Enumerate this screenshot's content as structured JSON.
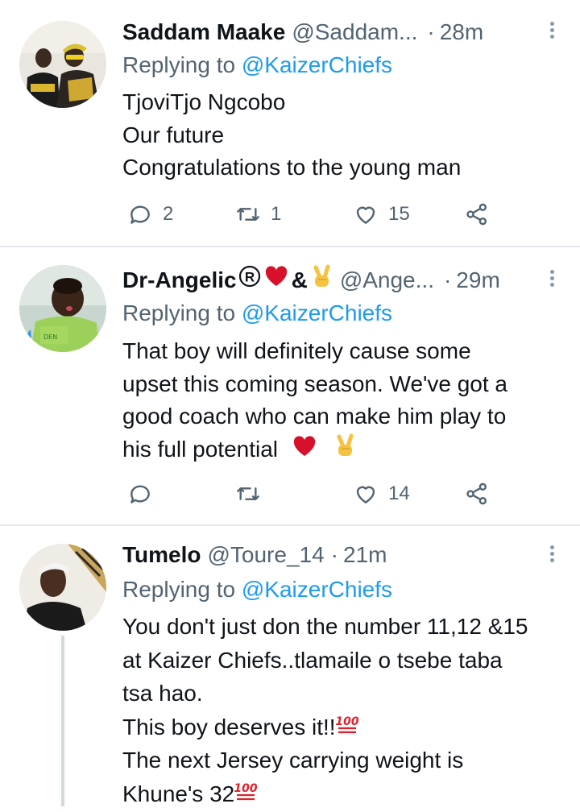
{
  "tweets": [
    {
      "name": "Saddam Maake",
      "handle": "@Saddam...",
      "time": "28m",
      "replying_prefix": "Replying to ",
      "replying_to": "@KaizerChiefs",
      "lines": [
        "TjoviTjo Ngcobo",
        "Our future",
        "Congratulations to the young man"
      ],
      "replies": "2",
      "retweets": "1",
      "likes": "15"
    },
    {
      "name": "Dr-Angelic",
      "name_suffix": "&",
      "handle": "@Ange...",
      "time": "29m",
      "replying_prefix": "Replying to ",
      "replying_to": "@KaizerChiefs",
      "lines": [
        "That boy will definitely cause some",
        "upset this coming season. We've got a",
        "good coach who can make him play to",
        "his full potential"
      ],
      "replies": "",
      "retweets": "",
      "likes": "14"
    },
    {
      "name": "Tumelo",
      "handle": "@Toure_14",
      "time": "21m",
      "replying_prefix": "Replying to ",
      "replying_to": "@KaizerChiefs",
      "lines": [
        "You don't just don the number 11,12 &15",
        "at Kaizer Chiefs..tlamaile o tsebe taba",
        "tsa hao.",
        "This boy deserves it!!",
        "The next Jersey carrying weight is",
        "Khune's 32"
      ]
    }
  ],
  "icons": {
    "reply": "reply-icon",
    "retweet": "retweet-icon",
    "like": "heart-icon",
    "share": "share-icon",
    "more": "more-icon",
    "registered": "registered-icon",
    "red_heart": "red-heart-emoji",
    "victory": "victory-hand-emoji",
    "hundred": "hundred-points-emoji"
  },
  "colors": {
    "link": "#1d9bf0",
    "secondary_text": "#536471",
    "primary_text": "#0f1419",
    "heart_emoji": "#d8102a",
    "hundred_emoji": "#e0202b"
  }
}
